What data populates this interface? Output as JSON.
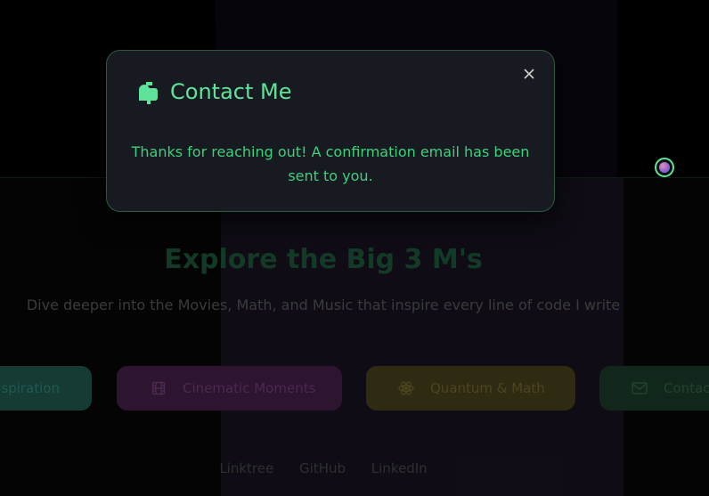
{
  "modal": {
    "title": "Contact Me",
    "message": "Thanks for reaching out! A confirmation email has been sent to you.",
    "close_icon": "close-icon",
    "title_icon": "mailbox-icon"
  },
  "hero": {
    "title": "Explore the Big 3 M's",
    "subtitle": "Dive deeper into the Movies, Math, and Music that inspire every line of code I write"
  },
  "cards": [
    {
      "label": "nspiration",
      "icon": ""
    },
    {
      "label": "Cinematic Moments",
      "icon": "film-icon"
    },
    {
      "label": "Quantum & Math",
      "icon": "atom-icon"
    },
    {
      "label": "Contac",
      "icon": "mail-icon"
    }
  ],
  "footer": {
    "links": [
      "Linktree",
      "GitHub",
      "LinkedIn"
    ]
  },
  "colors": {
    "accent": "#5fe39a",
    "message": "#3fd07c",
    "modal_bg": "#171a20"
  }
}
